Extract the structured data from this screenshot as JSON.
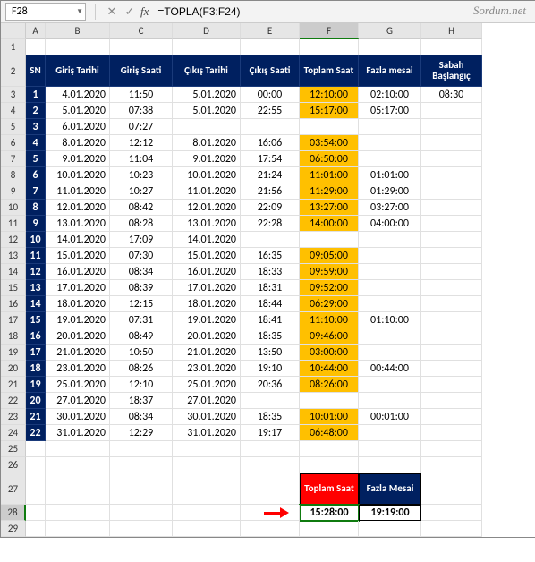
{
  "watermark": "Sordum.net",
  "nameBox": "F28",
  "formula": "=TOPLA(F3:F24)",
  "columns": [
    "A",
    "B",
    "C",
    "D",
    "E",
    "F",
    "G",
    "H"
  ],
  "rowCount": 29,
  "headers": {
    "A": "SN",
    "B": "Giriş Tarihi",
    "C": "Giriş Saati",
    "D": "Çıkış Tarihi",
    "E": "Çıkış Saati",
    "F": "Toplam Saat",
    "G": "Fazla mesai",
    "H": "Sabah Başlangıç"
  },
  "data": [
    {
      "sn": "1",
      "b": "4.01.2020",
      "c": "11:50",
      "d": "5.01.2020",
      "e": "00:00",
      "f": "12:10:00",
      "g": "02:10:00",
      "h": "08:30"
    },
    {
      "sn": "2",
      "b": "5.01.2020",
      "c": "07:38",
      "d": "5.01.2020",
      "e": "22:55",
      "f": "15:17:00",
      "g": "05:17:00",
      "h": ""
    },
    {
      "sn": "3",
      "b": "6.01.2020",
      "c": "07:27",
      "d": "",
      "e": "",
      "f": "",
      "g": "",
      "h": ""
    },
    {
      "sn": "4",
      "b": "8.01.2020",
      "c": "12:12",
      "d": "8.01.2020",
      "e": "16:06",
      "f": "03:54:00",
      "g": "",
      "h": ""
    },
    {
      "sn": "5",
      "b": "9.01.2020",
      "c": "11:04",
      "d": "9.01.2020",
      "e": "17:54",
      "f": "06:50:00",
      "g": "",
      "h": ""
    },
    {
      "sn": "6",
      "b": "10.01.2020",
      "c": "10:23",
      "d": "10.01.2020",
      "e": "21:24",
      "f": "11:01:00",
      "g": "01:01:00",
      "h": ""
    },
    {
      "sn": "7",
      "b": "11.01.2020",
      "c": "10:27",
      "d": "11.01.2020",
      "e": "21:56",
      "f": "11:29:00",
      "g": "01:29:00",
      "h": ""
    },
    {
      "sn": "8",
      "b": "12.01.2020",
      "c": "08:42",
      "d": "12.01.2020",
      "e": "22:09",
      "f": "13:27:00",
      "g": "03:27:00",
      "h": ""
    },
    {
      "sn": "9",
      "b": "13.01.2020",
      "c": "08:28",
      "d": "13.01.2020",
      "e": "22:28",
      "f": "14:00:00",
      "g": "04:00:00",
      "h": ""
    },
    {
      "sn": "10",
      "b": "14.01.2020",
      "c": "17:09",
      "d": "14.01.2020",
      "e": "",
      "f": "",
      "g": "",
      "h": ""
    },
    {
      "sn": "11",
      "b": "15.01.2020",
      "c": "07:30",
      "d": "15.01.2020",
      "e": "16:35",
      "f": "09:05:00",
      "g": "",
      "h": ""
    },
    {
      "sn": "12",
      "b": "16.01.2020",
      "c": "08:34",
      "d": "16.01.2020",
      "e": "18:33",
      "f": "09:59:00",
      "g": "",
      "h": ""
    },
    {
      "sn": "13",
      "b": "17.01.2020",
      "c": "08:39",
      "d": "17.01.2020",
      "e": "18:31",
      "f": "09:52:00",
      "g": "",
      "h": ""
    },
    {
      "sn": "14",
      "b": "18.01.2020",
      "c": "12:15",
      "d": "18.01.2020",
      "e": "18:44",
      "f": "06:29:00",
      "g": "",
      "h": ""
    },
    {
      "sn": "15",
      "b": "19.01.2020",
      "c": "07:31",
      "d": "19.01.2020",
      "e": "18:41",
      "f": "11:10:00",
      "g": "01:10:00",
      "h": ""
    },
    {
      "sn": "16",
      "b": "20.01.2020",
      "c": "08:49",
      "d": "20.01.2020",
      "e": "18:35",
      "f": "09:46:00",
      "g": "",
      "h": ""
    },
    {
      "sn": "17",
      "b": "21.01.2020",
      "c": "10:50",
      "d": "21.01.2020",
      "e": "13:50",
      "f": "03:00:00",
      "g": "",
      "h": ""
    },
    {
      "sn": "18",
      "b": "23.01.2020",
      "c": "08:26",
      "d": "23.01.2020",
      "e": "19:10",
      "f": "10:44:00",
      "g": "00:44:00",
      "h": ""
    },
    {
      "sn": "19",
      "b": "25.01.2020",
      "c": "12:10",
      "d": "25.01.2020",
      "e": "20:36",
      "f": "08:26:00",
      "g": "",
      "h": ""
    },
    {
      "sn": "20",
      "b": "27.01.2020",
      "c": "18:37",
      "d": "27.01.2020",
      "e": "",
      "f": "",
      "g": "",
      "h": ""
    },
    {
      "sn": "21",
      "b": "30.01.2020",
      "c": "08:34",
      "d": "30.01.2020",
      "e": "18:35",
      "f": "10:01:00",
      "g": "00:01:00",
      "h": ""
    },
    {
      "sn": "22",
      "b": "31.01.2020",
      "c": "12:29",
      "d": "31.01.2020",
      "e": "19:17",
      "f": "06:48:00",
      "g": "",
      "h": ""
    }
  ],
  "summary": {
    "f_header": "Toplam Saat",
    "g_header": "Fazla Mesai",
    "f_value": "15:28:00",
    "g_value": "19:19:00"
  },
  "activeCell": {
    "row": 28,
    "col": "F"
  }
}
